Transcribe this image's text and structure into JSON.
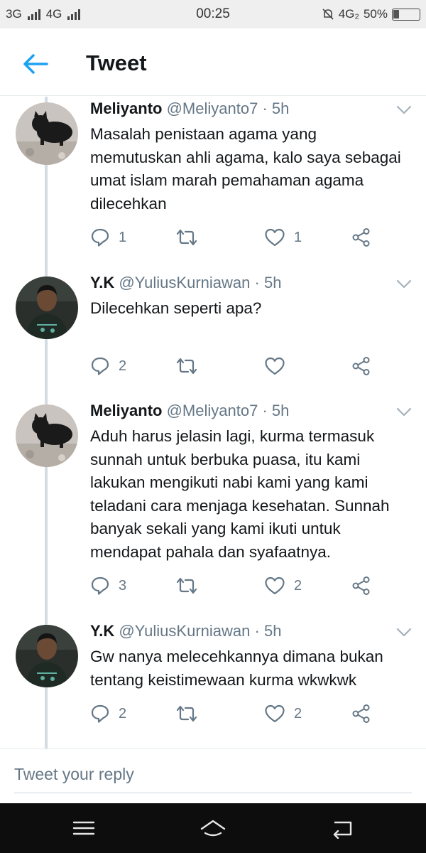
{
  "status_bar": {
    "network_left": [
      "3G",
      "4G"
    ],
    "time": "00:25",
    "network_right": "4G₂",
    "battery": "50%"
  },
  "header": {
    "title": "Tweet",
    "back_icon": "arrow-left-icon"
  },
  "tweets": [
    {
      "display_name": "Meliyanto",
      "handle": "@Meliyanto7",
      "separator": "·",
      "time": "5h",
      "text": "Masalah penistaan agama yang memutuskan ahli agama, kalo saya sebagai umat islam marah pemahaman agama dilecehkan",
      "replies": "1",
      "retweets": "",
      "likes": "1",
      "avatar": "black-cat"
    },
    {
      "display_name": "Y.K",
      "handle": "@YuliusKurniawan",
      "separator": "·",
      "time": "5h",
      "text": "Dilecehkan seperti apa?",
      "replies": "2",
      "retweets": "",
      "likes": "",
      "avatar": "person"
    },
    {
      "display_name": "Meliyanto",
      "handle": "@Meliyanto7",
      "separator": "·",
      "time": "5h",
      "text": "Aduh harus jelasin lagi, kurma termasuk sunnah untuk berbuka puasa, itu kami lakukan mengikuti nabi kami yang kami teladani cara menjaga kesehatan. Sunnah banyak sekali yang kami ikuti untuk mendapat pahala dan syafaatnya.",
      "replies": "3",
      "retweets": "",
      "likes": "2",
      "avatar": "black-cat"
    },
    {
      "display_name": "Y.K",
      "handle": "@YuliusKurniawan",
      "separator": "·",
      "time": "5h",
      "text": "Gw nanya melecehkannya dimana bukan tentang keistimewaan kurma wkwkwk",
      "replies": "2",
      "retweets": "",
      "likes": "2",
      "avatar": "person"
    }
  ],
  "reply": {
    "placeholder": "Tweet your reply"
  },
  "colors": {
    "accent": "#1da1f2",
    "text_primary": "#14171a",
    "text_secondary": "#657786",
    "thread_line": "#d4dbe1",
    "nav_bar": "#0d0d0d"
  },
  "icons": [
    "reply-icon",
    "retweet-icon",
    "like-icon",
    "share-icon",
    "chevron-down-icon",
    "menu-icon",
    "home-icon",
    "back-nav-icon"
  ]
}
